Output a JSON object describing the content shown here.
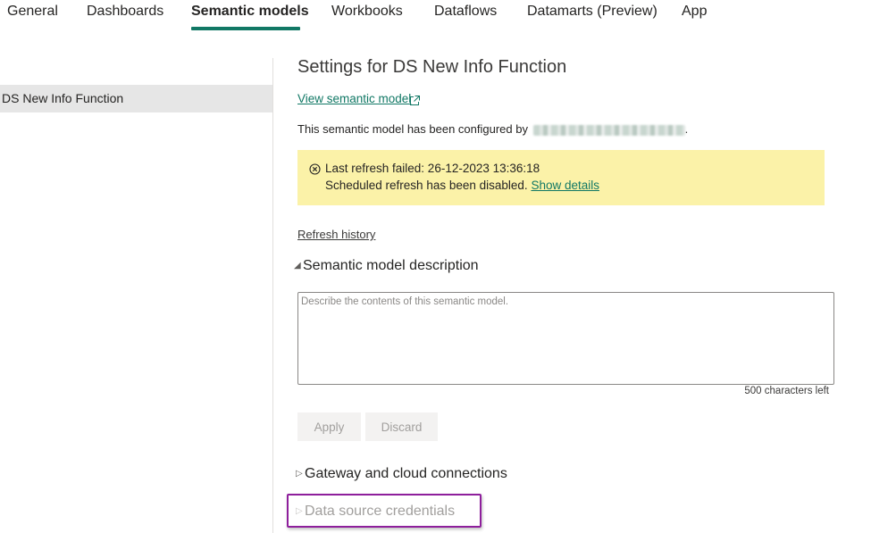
{
  "tabs": [
    {
      "label": "General",
      "active": false
    },
    {
      "label": "Dashboards",
      "active": false
    },
    {
      "label": "Semantic models",
      "active": true
    },
    {
      "label": "Workbooks",
      "active": false
    },
    {
      "label": "Dataflows",
      "active": false
    },
    {
      "label": "Datamarts (Preview)",
      "active": false
    },
    {
      "label": "App",
      "active": false
    }
  ],
  "left_list": {
    "items": [
      {
        "label": "DS New Info Function",
        "selected": true
      }
    ]
  },
  "settings": {
    "title": "Settings for DS New Info Function",
    "view_link": "View semantic model",
    "external_icon": "external-link-icon",
    "configured_by_text": "This semantic model has been configured by",
    "configured_by_suffix": "."
  },
  "warning": {
    "icon": "error-circle-icon",
    "line1": "Last refresh failed: 26-12-2023 13:36:18",
    "line2": "Scheduled refresh has been disabled.",
    "show_details": "Show details",
    "background_color": "#fbf2a8"
  },
  "refresh_history": "Refresh history",
  "description_section": {
    "title": "Semantic model description",
    "expanded_icon": "triangle-expanded-icon",
    "textarea_value": "",
    "textarea_placeholder": "Describe the contents of this semantic model.",
    "chars_left": "500 characters left",
    "apply_label": "Apply",
    "discard_label": "Discard"
  },
  "gateway_section": {
    "title": "Gateway and cloud connections",
    "collapsed_icon": "triangle-collapsed-icon"
  },
  "datasource_section": {
    "title": "Data source credentials",
    "collapsed_icon": "triangle-collapsed-icon",
    "highlight_color": "#8e1f9c"
  },
  "colors": {
    "accent": "#117865",
    "text": "#252423",
    "disabled_text": "#a19f9d"
  }
}
